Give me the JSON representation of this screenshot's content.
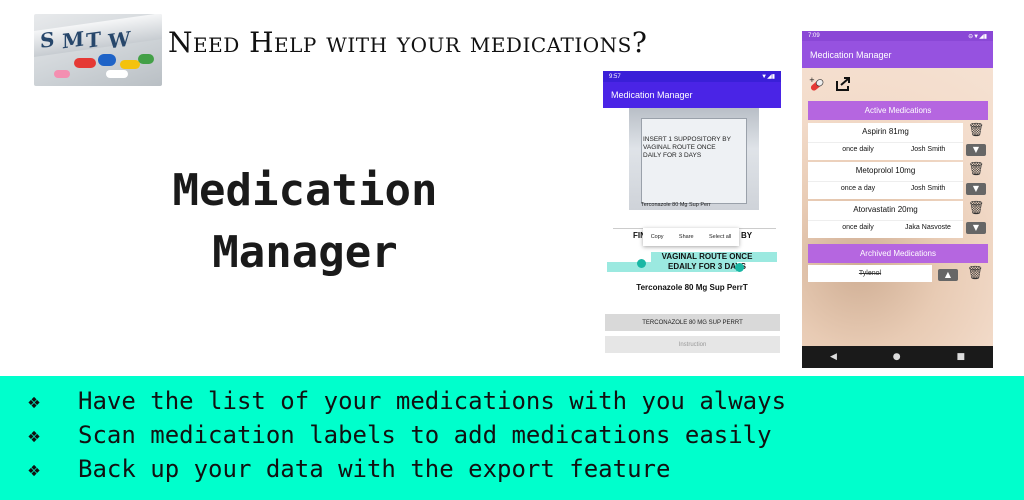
{
  "header": {
    "tagline": "Need Help with your medications?",
    "title_line1": "Medication",
    "title_line2": "Manager"
  },
  "phone1": {
    "status_time": "9:57",
    "status_icons": "▼◢▮",
    "app_title": "Medication Manager",
    "photo_text": "INSERT 1 SUPPOSITORY BY\nVAGINAL ROUTE ONCE\nDAILY FOR 3 DAYS",
    "photo_bottom": "Terconazole 80 Mg Sup Perr",
    "fin_fragment": "FIN",
    "by_fragment": "BY",
    "context_menu": [
      "Copy",
      "Share",
      "Select all"
    ],
    "selected_line1": "VAGINAL ROUTE ONCE",
    "selected_line2": "EDAILY FOR 3 DAYS",
    "medication_line": "Terconazole 80 Mg Sup PerrT",
    "button_medication": "TERCONAZOLE 80 MG SUP PERRT",
    "button_instruction": "Instruction"
  },
  "phone2": {
    "status_time": "7:09",
    "status_icons": "⊖▼◢▮",
    "app_title": "Medication Manager",
    "toolbar_icons": [
      "add-medication-icon",
      "export-icon"
    ],
    "active_header": "Active Medications",
    "active": [
      {
        "name": "Aspirin 81mg",
        "frequency": "once daily",
        "doctor": "Josh Smith"
      },
      {
        "name": "Metoprolol 10mg",
        "frequency": "once a day",
        "doctor": "Josh Smith"
      },
      {
        "name": "Atorvastatin 20mg",
        "frequency": "once daily",
        "doctor": "Jaka Nasvoste"
      }
    ],
    "archived_header": "Archived Medications",
    "archived": [
      {
        "name": "Tylenol"
      }
    ],
    "nav": [
      "◀",
      "●",
      "■"
    ]
  },
  "features": [
    "Have the list of your medications with you always",
    "Scan medication labels to add medications easily",
    "Back up your data with the export feature"
  ],
  "feature_bullet": "❖",
  "colors": {
    "band": "#00ffcc",
    "phone1_appbar": "#4a24e6",
    "phone2_appbar": "#9652e0",
    "section_header": "#b566e0"
  }
}
